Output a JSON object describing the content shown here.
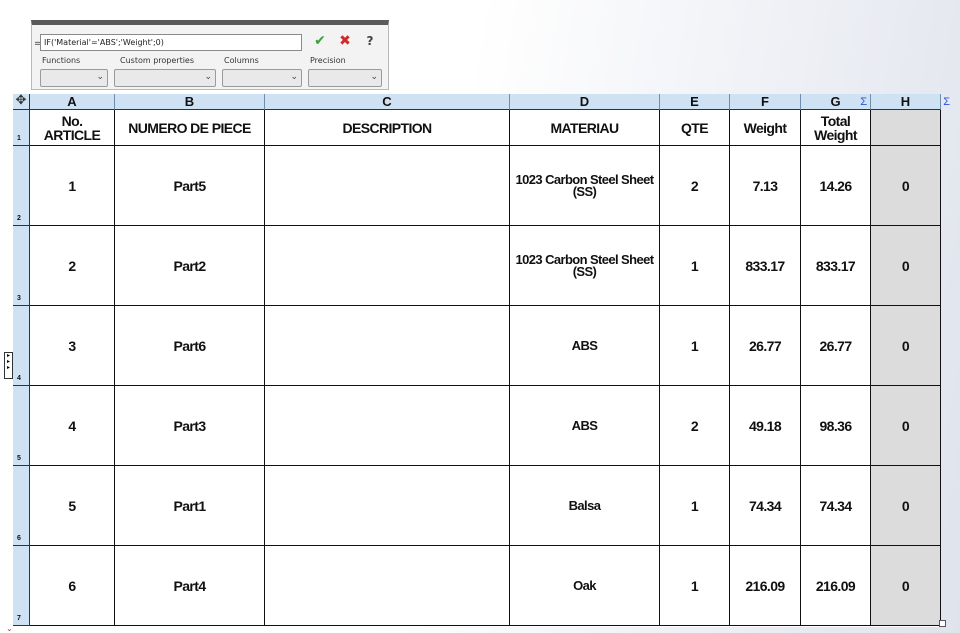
{
  "formula_bar": {
    "equals": "=",
    "formula": "IF('Material'='ABS';'Weight';0)",
    "labels": {
      "functions": "Functions",
      "custom_properties": "Custom properties",
      "columns": "Columns",
      "precision": "Precision"
    }
  },
  "icons": {
    "accept": "✔",
    "cancel": "✖",
    "help": "?",
    "sigma": "Σ",
    "move": "✥",
    "chevron": "⌄"
  },
  "sheet": {
    "column_letters": [
      "A",
      "B",
      "C",
      "D",
      "E",
      "F",
      "G",
      "H"
    ],
    "row_numbers": [
      "1",
      "2",
      "3",
      "4",
      "5",
      "6",
      "7"
    ],
    "headers": [
      "No.\nARTICLE",
      "NUMERO DE PIECE",
      "DESCRIPTION",
      "MATERIAU",
      "QTE",
      "Weight",
      "Total\nWeight",
      ""
    ],
    "rows": [
      [
        "1",
        "Part5",
        "",
        "1023 Carbon Steel Sheet (SS)",
        "2",
        "7.13",
        "14.26",
        "0"
      ],
      [
        "2",
        "Part2",
        "",
        "1023 Carbon Steel Sheet (SS)",
        "1",
        "833.17",
        "833.17",
        "0"
      ],
      [
        "3",
        "Part6",
        "",
        "ABS",
        "1",
        "26.77",
        "26.77",
        "0"
      ],
      [
        "4",
        "Part3",
        "",
        "ABS",
        "2",
        "49.18",
        "98.36",
        "0"
      ],
      [
        "5",
        "Part1",
        "",
        "Balsa",
        "1",
        "74.34",
        "74.34",
        "0"
      ],
      [
        "6",
        "Part4",
        "",
        "Oak",
        "1",
        "216.09",
        "216.09",
        "0"
      ]
    ]
  },
  "colors": {
    "header_blue": "#cfe2f3",
    "sigma_blue": "#2b55d6",
    "accept_green": "#3aa03a",
    "cancel_red": "#d42828",
    "selected_column_gray": "#dcdcdc"
  }
}
